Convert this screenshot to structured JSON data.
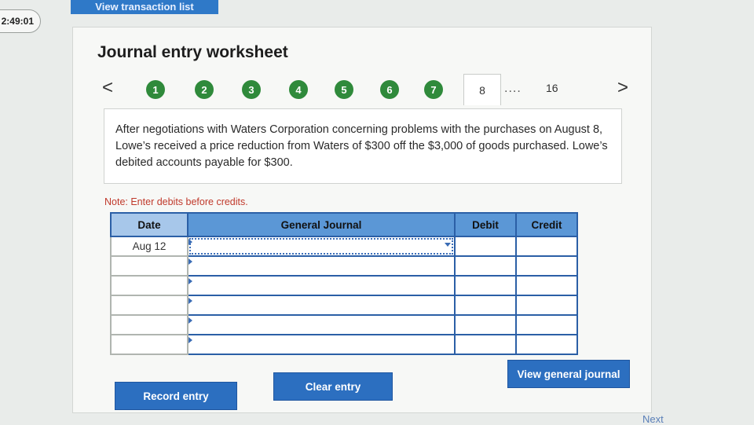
{
  "timer": "2:49:01",
  "top_button": "View transaction list",
  "worksheet": {
    "title": "Journal entry worksheet",
    "prev_arrow": "<",
    "next_arrow": ">",
    "steps": [
      "1",
      "2",
      "3",
      "4",
      "5",
      "6",
      "7"
    ],
    "current_step": "8",
    "ellipsis": "....",
    "last_step": "16",
    "question": "After negotiations with Waters Corporation concerning problems with the purchases on August 8, Lowe’s received a price reduction from Waters of $300 off the $3,000 of goods purchased. Lowe’s debited accounts payable for $300.",
    "note": "Note: Enter debits before credits."
  },
  "table": {
    "headers": {
      "date": "Date",
      "general_journal": "General Journal",
      "debit": "Debit",
      "credit": "Credit"
    },
    "rows": [
      {
        "date": "Aug 12",
        "account": "",
        "debit": "",
        "credit": ""
      },
      {
        "date": "",
        "account": "",
        "debit": "",
        "credit": ""
      },
      {
        "date": "",
        "account": "",
        "debit": "",
        "credit": ""
      },
      {
        "date": "",
        "account": "",
        "debit": "",
        "credit": ""
      },
      {
        "date": "",
        "account": "",
        "debit": "",
        "credit": ""
      },
      {
        "date": "",
        "account": "",
        "debit": "",
        "credit": ""
      }
    ]
  },
  "buttons": {
    "record": "Record entry",
    "clear": "Clear entry",
    "view_journal": "View general journal"
  },
  "footer": {
    "next": "Next"
  },
  "colors": {
    "step_complete": "#2f8a3b",
    "button": "#2c6fc0",
    "header": "#5b97d6",
    "note": "#c0392b"
  }
}
